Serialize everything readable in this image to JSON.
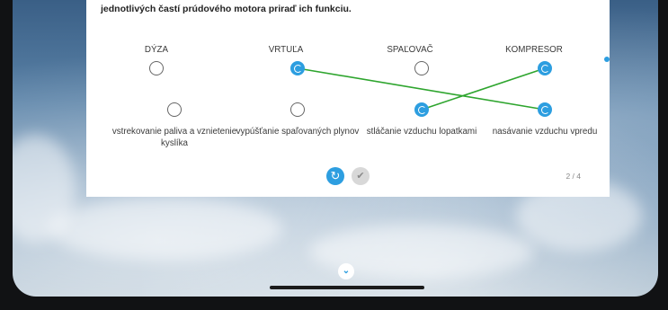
{
  "instruction": "jednotlivých častí prúdového motora priraď ich funkciu.",
  "top_items": [
    {
      "label": "DÝZA",
      "state": "empty"
    },
    {
      "label": "VRTUĽA",
      "state": "selected"
    },
    {
      "label": "SPAĽOVAČ",
      "state": "empty"
    },
    {
      "label": "KOMPRESOR",
      "state": "selected"
    }
  ],
  "bottom_items": [
    {
      "label": "vstrekovanie paliva a vznietenie kyslíka",
      "state": "empty"
    },
    {
      "label": "vypúšťanie spaľovaných plynov",
      "state": "empty"
    },
    {
      "label": "stláčanie vzduchu lopatkami",
      "state": "selected"
    },
    {
      "label": "nasávanie vzduchu vpredu",
      "state": "selected"
    }
  ],
  "connections": [
    {
      "from": "VRTUĽA",
      "to": "nasávanie vzduchu vpredu"
    },
    {
      "from": "KOMPRESOR",
      "to": "stláčanie vzduchu lopatkami"
    }
  ],
  "controls": {
    "refresh_icon": "refresh-icon",
    "check_icon": "check-icon",
    "page_indicator": "2 / 4"
  },
  "side_dots": {
    "count": 3,
    "active": 0
  },
  "colors": {
    "accent": "#2d9ee0",
    "connection_line": "#2ea52e"
  }
}
